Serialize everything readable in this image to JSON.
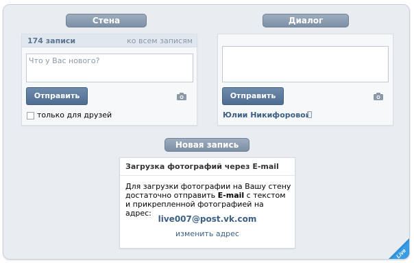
{
  "wall": {
    "title": "Стена",
    "count": "174 записи",
    "all_link": "ко всем записям",
    "placeholder": "Что у Вас нового?",
    "send_label": "Отправить",
    "friends_only_label": "только для друзей"
  },
  "dialog": {
    "title": "Диалог",
    "send_label": "Отправить",
    "recipient": "Юлии Никифоровой"
  },
  "new_post": {
    "title": "Новая запись",
    "panel_title": "Загрузка фотографий через E-mail",
    "body_part1": "Для загрузки фотографии на Вашу стену достаточно отправить ",
    "body_bold": "E-mail",
    "body_part2": " с текстом и прикрепленной фотографией на адрес:",
    "email": "live007@post.vk.com",
    "change_link": "изменить адрес"
  },
  "corner_badge": "Live",
  "icons": [
    "camera-icon",
    "camera-icon",
    "checkbox",
    "phone-icon"
  ],
  "colors": {
    "frame_bg": "#e9edf1",
    "pill": "#8a9bb0",
    "button": "#5a7899",
    "link": "#3b5f85",
    "badge": "#2f8fd6"
  }
}
